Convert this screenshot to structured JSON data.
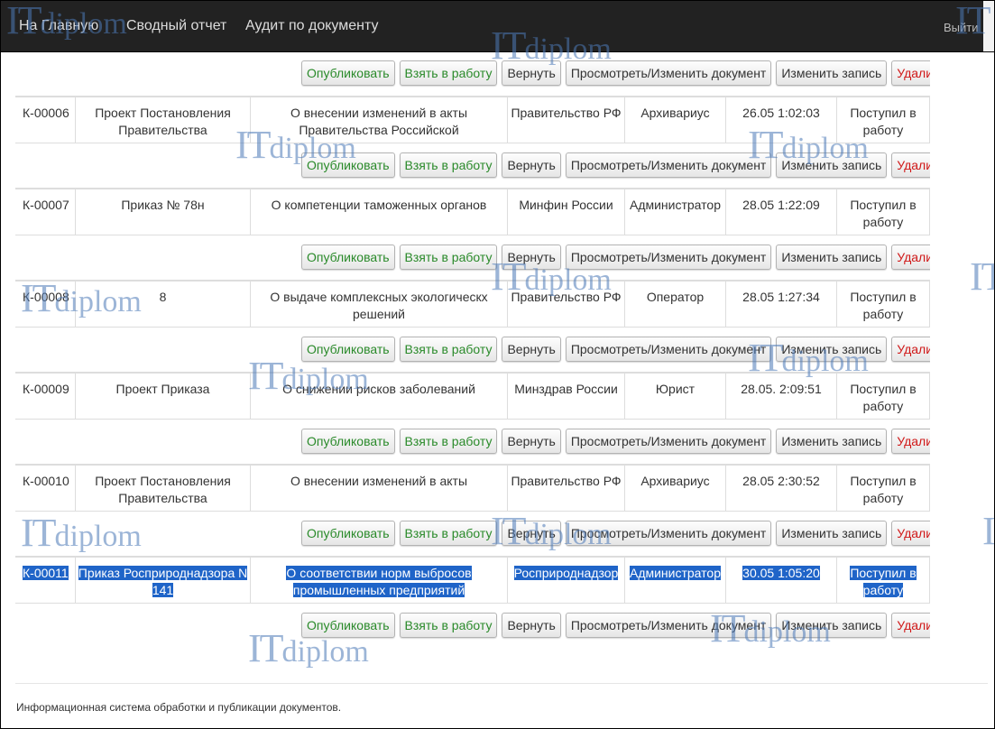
{
  "nav": {
    "home": "На Главную",
    "report": "Сводный отчет",
    "audit": "Аудит по документу",
    "logout": "Выйти"
  },
  "actions": {
    "publish": "Опубликовать",
    "take": "Взять в работу",
    "return": "Вернуть",
    "view": "Просмотреть/Изменить документ",
    "edit": "Изменить запись",
    "delete": "Удалить"
  },
  "records": [
    {
      "num": "К-00006",
      "kind": "Проект Постановления Правительства",
      "title": "О внесении изменений в акты Правительства Российской",
      "org": "Правительство РФ",
      "role": "Архивариус",
      "date": "26.05 1:02:03",
      "status": "Поступил в работу",
      "selected": false
    },
    {
      "num": "К-00007",
      "kind": "Приказ № 78н",
      "title": "О компетенции таможенных органов",
      "org": "Минфин России",
      "role": "Администратор",
      "date": "28.05 1:22:09",
      "status": "Поступил в работу",
      "selected": false
    },
    {
      "num": "К-00008",
      "kind": "8",
      "title": "О выдаче комплексных экологическх решений",
      "org": "Правительство РФ",
      "role": "Оператор",
      "date": "28.05 1:27:34",
      "status": "Поступил в работу",
      "selected": false
    },
    {
      "num": "К-00009",
      "kind": "Проект Приказа",
      "title": "О снижении рисков заболеваний",
      "org": "Минздрав России",
      "role": "Юрист",
      "date": "28.05. 2:09:51",
      "status": "Поступил в работу",
      "selected": false
    },
    {
      "num": "К-00010",
      "kind": "Проект Постановления Правительства",
      "title": "О внесении изменений в акты",
      "org": "Правительство РФ",
      "role": "Архивариус",
      "date": "28.05 2:30:52",
      "status": "Поступил в работу",
      "selected": false
    },
    {
      "num": "К-00011",
      "kind": "Приказ Росприроднадзора N 141",
      "title": "О соответствии норм выбросов промышленных предприятий",
      "org": "Росприроднадзор",
      "role": "Администратор",
      "date": "30.05 1:05:20",
      "status": "Поступил в работу",
      "selected": true
    }
  ],
  "footer": "Информационная система обработки и публикации документов.",
  "watermark": {
    "it": "IT",
    "rest": "diplom"
  },
  "colors": {
    "navbar": "#222222",
    "selection": "#1f64c8",
    "positive": "#2a8a2a",
    "danger": "#d01818"
  }
}
